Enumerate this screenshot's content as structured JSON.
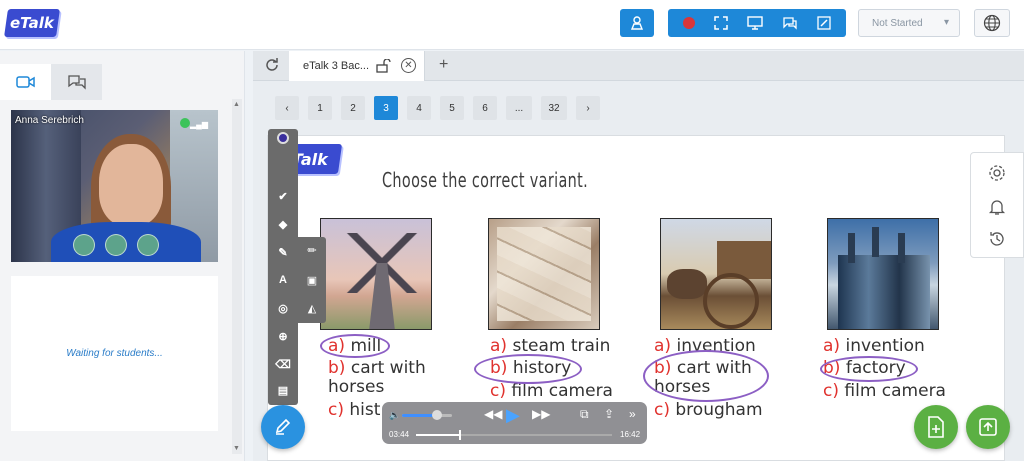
{
  "app": {
    "logo_text": "eTalk"
  },
  "toolbar": {
    "status_value": "Not Started",
    "icons": [
      "teacher-icon",
      "record-icon",
      "fullscreen-icon",
      "screen-share-icon",
      "chat-icon",
      "edit-icon",
      "globe-icon"
    ]
  },
  "left": {
    "participant_name": "Anna Serebrich",
    "waiting_text": "Waiting for students..."
  },
  "tabs": {
    "doc_tab_label": "eTalk 3 Bac...",
    "add_label": "+",
    "close_label": "✕"
  },
  "pager": {
    "pages": [
      "1",
      "2",
      "3",
      "4",
      "5",
      "6",
      "...",
      "32"
    ],
    "current": "3",
    "prev": "‹",
    "next": "›"
  },
  "slide": {
    "logo_text": "eTalk",
    "instruction": "Choose the correct variant.",
    "columns": [
      {
        "image": "windmill",
        "options": [
          {
            "letter": "a)",
            "text": "mill"
          },
          {
            "letter": "b)",
            "text": "cart with"
          },
          {
            "letter": "",
            "text": "horses"
          },
          {
            "letter": "c)",
            "text": "hist"
          }
        ]
      },
      {
        "image": "old newspapers",
        "options": [
          {
            "letter": "a)",
            "text": "steam train"
          },
          {
            "letter": "b)",
            "text": "history"
          },
          {
            "letter": "c)",
            "text": "film camera"
          }
        ]
      },
      {
        "image": "horse cart",
        "options": [
          {
            "letter": "a)",
            "text": "invention"
          },
          {
            "letter": "b)",
            "text": "cart with"
          },
          {
            "letter": "",
            "text": "horses"
          },
          {
            "letter": "c)",
            "text": "brougham"
          }
        ]
      },
      {
        "image": "factory",
        "options": [
          {
            "letter": "a)",
            "text": "invention"
          },
          {
            "letter": "b)",
            "text": "factory"
          },
          {
            "letter": "c)",
            "text": "film camera"
          }
        ]
      }
    ]
  },
  "player": {
    "current_time": "03:44",
    "total_time": "16:42",
    "progress": 0.22,
    "volume": 0.7
  },
  "colors": {
    "accent": "#1e88d8",
    "option_letter": "#e0322e",
    "annotation": "#8c5fc4",
    "fab_green": "#5bb043"
  }
}
